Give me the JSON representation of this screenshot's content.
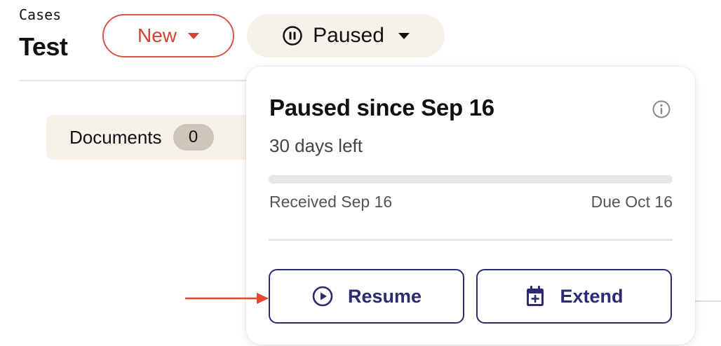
{
  "header": {
    "breadcrumb": "Cases",
    "title": "Test",
    "status_button": {
      "label": "New",
      "color": "#d6412f"
    },
    "pause_button": {
      "label": "Paused",
      "icon": "pause-circle-icon"
    }
  },
  "documents": {
    "label": "Documents",
    "count": "0"
  },
  "pause_popover": {
    "title": "Paused since Sep 16",
    "info_icon": "info-icon",
    "days_left": "30 days left",
    "progress_fraction": 0,
    "received_label": "Received Sep 16",
    "due_label": "Due Oct 16",
    "resume_label": "Resume",
    "resume_icon": "play-circle-icon",
    "extend_label": "Extend",
    "extend_icon": "calendar-plus-icon"
  },
  "annotation": {
    "arrow_color": "#e8452c",
    "target": "resume-button"
  },
  "colors": {
    "accent": "#2c2a72",
    "chip_background": "#f6f2ea",
    "status_red": "#d6412f"
  }
}
